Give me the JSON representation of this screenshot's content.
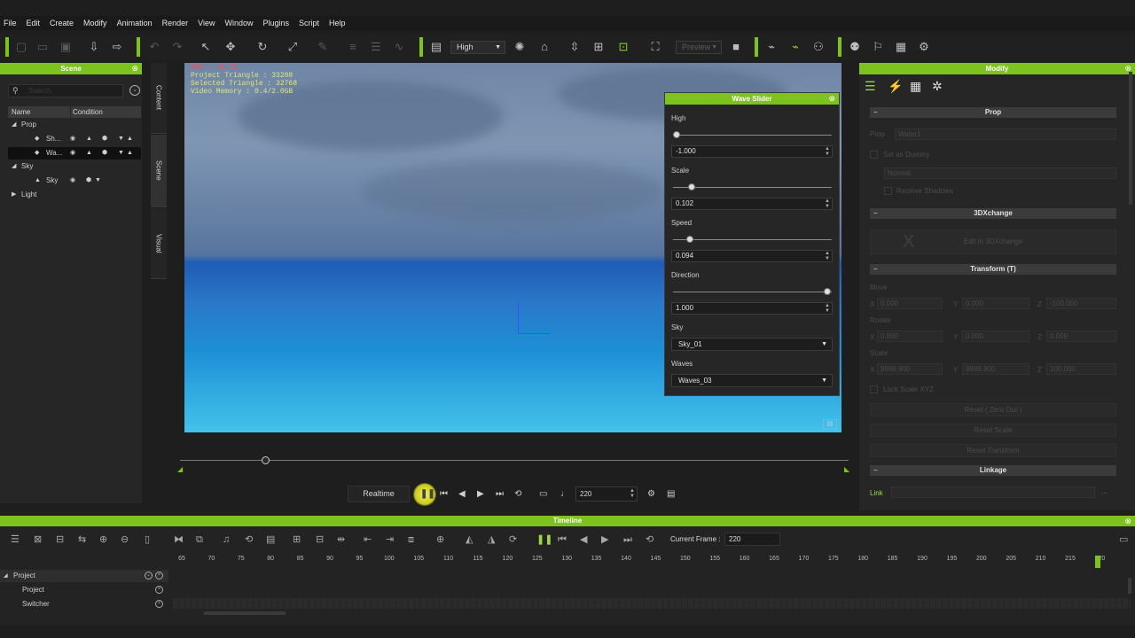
{
  "menu": [
    "File",
    "Edit",
    "Create",
    "Modify",
    "Animation",
    "Render",
    "View",
    "Window",
    "Plugins",
    "Script",
    "Help"
  ],
  "toolbar": {
    "quality": "High",
    "preview": "Preview"
  },
  "colors": {
    "accent": "#7dc21e",
    "panel": "#262626",
    "hud_text": "#e4e47a",
    "hud_fps": "#ff4a4a"
  },
  "scene_panel": {
    "title": "Scene",
    "search_placeholder": "Search",
    "columns": [
      "Name",
      "Condition"
    ],
    "rows": [
      {
        "label": "Prop",
        "level": 0
      },
      {
        "label": "Sh...",
        "level": 1
      },
      {
        "label": "Wa...",
        "level": 1,
        "selected": true
      },
      {
        "label": "Sky",
        "level": 0
      },
      {
        "label": "Sky",
        "level": 1
      },
      {
        "label": "Light",
        "level": 0
      }
    ]
  },
  "side_tabs": [
    "Content",
    "Scene",
    "Visual"
  ],
  "viewport": {
    "fps": "FPS : 46.71",
    "project_triangle": "Project Triangle : 33288",
    "selected_triangle": "Selected Triangle : 32768",
    "video_memory": "Video Memory : 0.4/2.0GB"
  },
  "wave_slider": {
    "title": "Wave Slider",
    "params": [
      {
        "label": "High",
        "value": "-1.000",
        "position": 0.0
      },
      {
        "label": "Scale",
        "value": "0.102",
        "position": 0.1
      },
      {
        "label": "Speed",
        "value": "0.094",
        "position": 0.09
      },
      {
        "label": "Direction",
        "value": "1.000",
        "position": 1.0
      }
    ],
    "sky_label": "Sky",
    "sky_value": "Sky_01",
    "waves_label": "Waves",
    "waves_value": "Waves_03"
  },
  "modify_panel": {
    "title": "Modify",
    "prop_section": "Prop",
    "prop_label": "Prop",
    "prop_value": "Water1",
    "set_as_dummy": "Set as Dummy",
    "normal": "Normal",
    "receive_shadows": "Receive Shadows",
    "threedx_section": "3DXchange",
    "edit_in_3dx": "Edit in 3DXchange",
    "transform_section": "Transform (T)",
    "move_label": "Move",
    "move": [
      "0.000",
      "0.000",
      "-100.000"
    ],
    "rotate_label": "Rotate",
    "rotate": [
      "0.000",
      "0.000",
      "0.000"
    ],
    "scale_label": "Scale",
    "scale": [
      "9999.900",
      "9999.900",
      "100.000"
    ],
    "axis": [
      "X",
      "Y",
      "Z"
    ],
    "lock_scale": "Lock Scale XYZ",
    "reset_zero": "Reset ( Zero Out )",
    "reset_scale": "Reset Scale",
    "reset_transform": "Reset Transform",
    "linkage_section": "Linkage",
    "link_label": "Link"
  },
  "transport": {
    "mode": "Realtime",
    "frame": "220"
  },
  "playback_position": 0.126,
  "timeline": {
    "title": "Timeline",
    "current_frame_label": "Current Frame :",
    "current_frame": "220",
    "ticks": [
      "65",
      "70",
      "75",
      "80",
      "85",
      "90",
      "95",
      "100",
      "105",
      "110",
      "115",
      "120",
      "125",
      "130",
      "135",
      "140",
      "145",
      "150",
      "155",
      "160",
      "165",
      "170",
      "175",
      "180",
      "185",
      "190",
      "195",
      "200",
      "205",
      "210",
      "215",
      "220"
    ],
    "tracks": [
      "Project",
      "Project",
      "Switcher"
    ]
  }
}
